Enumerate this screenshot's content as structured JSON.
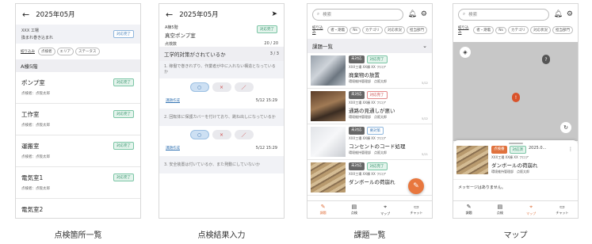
{
  "screens": {
    "s1": {
      "caption": "点検箇所一覧",
      "title": "2025年05月",
      "site_name": "XXX 工場",
      "site_sub": "換まれ巻き込まれ",
      "site_badge": "対応完了",
      "filter_label": "絞り込み",
      "filters": [
        "点検者",
        "エリア",
        "ステータス"
      ],
      "section": "A棟5階",
      "rows": [
        {
          "name": "ポンプ室",
          "person": "点検者：点阪太郎",
          "badge": "対応完了"
        },
        {
          "name": "工作室",
          "person": "点検者：点阪太郎",
          "badge": "対応完了"
        },
        {
          "name": "運搬室",
          "person": "点検者：点阪太郎",
          "badge": "対応完了"
        },
        {
          "name": "電気室1",
          "person": "点検者：点阪太郎",
          "badge": "対応完了"
        },
        {
          "name": "電気室2",
          "person": "",
          "badge": ""
        }
      ]
    },
    "s2": {
      "caption": "点検結果入力",
      "title": "2025年05月",
      "area": "A棟5階",
      "room": "真空ポンプ室",
      "room_badge": "対応完了",
      "progress_label": "点検数",
      "progress": "20 / 20",
      "section": "工学的対策がされているか",
      "section_count": "3 / 3",
      "questions": [
        {
          "text": "1. 稼働で巻きれずり、作業者が中に入れない構造となっているか",
          "link": "課題作成",
          "date": "5/12 15:29"
        },
        {
          "text": "2. 回転体に保護カバーを付けており、跳ね出しになっているか",
          "link": "課題作成",
          "date": "5/12 15:29"
        },
        {
          "text": "3. 安全装置は付いているか、また発動にしていないか",
          "link": "",
          "date": ""
        }
      ],
      "opt_ok": "○",
      "opt_ng": "×",
      "opt_na": "／"
    },
    "s3": {
      "caption": "課題一覧",
      "search_placeholder": "検索",
      "filter_label": "絞り込み",
      "filters": [
        "者・期着",
        "Ns",
        "カテゴリ",
        "対応状況",
        "担当部門"
      ],
      "section": "課題一覧",
      "cards": [
        {
          "status": "未対応",
          "status2": "対応完了",
          "loc": "XXX工場 XX棟 XX フロア",
          "title": "廃棄物の放置",
          "person": "環境維持管理部　点阪太郎",
          "date": "5/22"
        },
        {
          "status": "未対応",
          "status2": "対応完了",
          "loc": "XXX工場 XX棟 XX フロア",
          "title": "通路の見通しが悪い",
          "person": "環境維持管理部　点阪太郎",
          "date": "5/22"
        },
        {
          "status": "未対応",
          "status2": "要対策",
          "loc": "XXX工場 XX棟 XX フロア",
          "title": "コンセントのコード処理",
          "person": "環境維持管理部　点阪太郎",
          "date": "5/21"
        },
        {
          "status": "未対応",
          "status2": "対応完了",
          "loc": "XXX工場 XX棟 XX フロア",
          "title": "ダンボールの荷崩れ",
          "person": "環境維持管理部　点阪太郎",
          "date": ""
        }
      ],
      "tabs": [
        "課題",
        "点検",
        "マップ",
        "チャット"
      ]
    },
    "s4": {
      "caption": "マップ",
      "search_placeholder": "検索",
      "filter_label": "絞り込み",
      "filters": [
        "者・期着",
        "Ns",
        "カテゴリ",
        "対応状況",
        "担当部門"
      ],
      "card_status": "点検番",
      "card_status2": "対応済",
      "card_date": "2025.0...",
      "card_loc": "XXX工場 XX棟 XX フロア",
      "card_title": "ダンボールの荷崩れ",
      "card_person": "環境維持管理部　点阪太郎",
      "message": "メッセージはありません。",
      "tabs": [
        "課題",
        "点検",
        "マップ",
        "チャット"
      ]
    }
  },
  "colors": {
    "accent": "#e0723e",
    "done": "#2f8f69",
    "map": "#c7c7c7"
  }
}
